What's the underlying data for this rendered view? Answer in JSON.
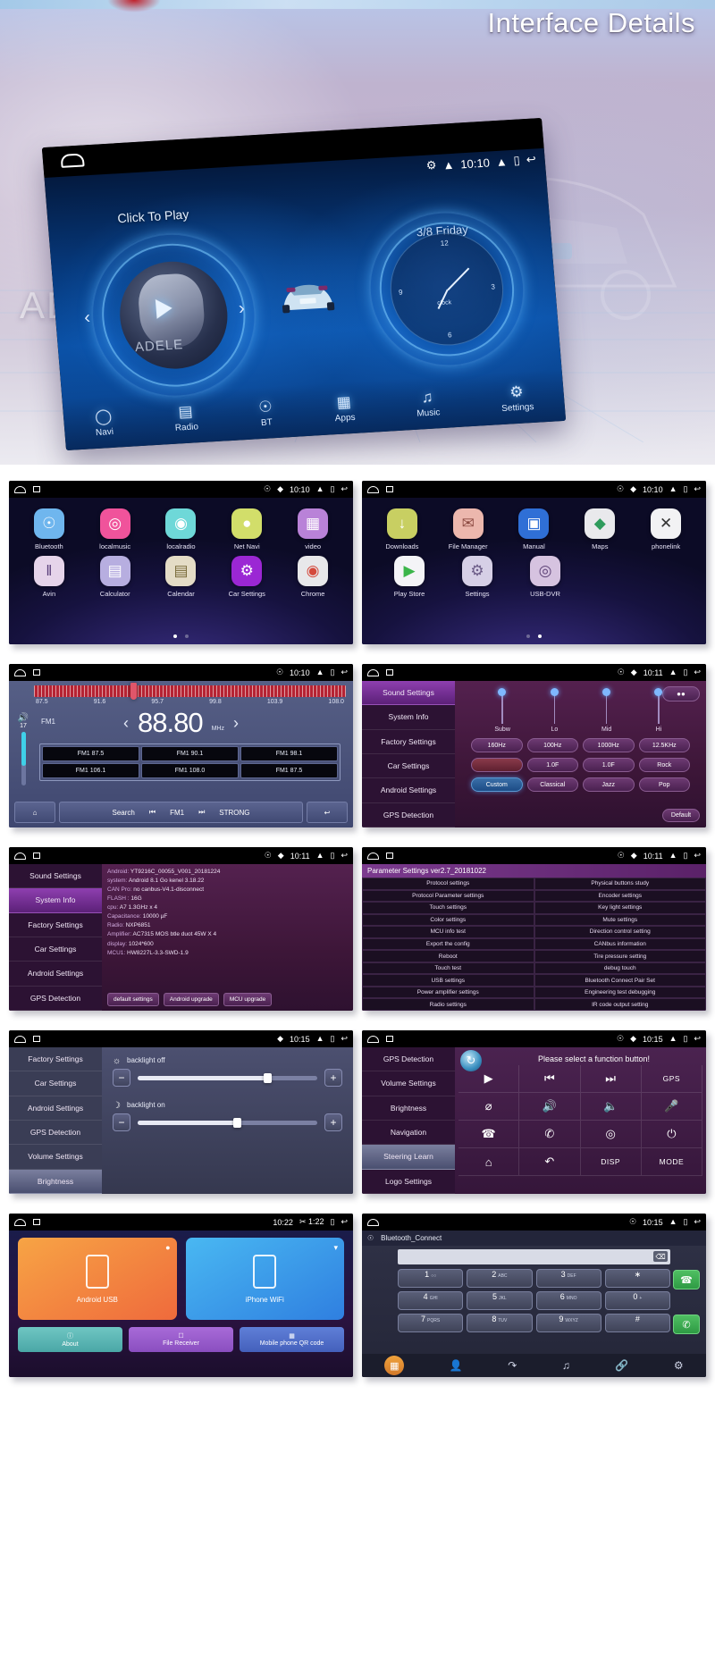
{
  "hero": {
    "title": "Interface Details",
    "watermark": "AD",
    "device": {
      "status": {
        "bt_icon": "bluetooth-icon",
        "wifi_icon": "wifi-icon",
        "time": "10:10",
        "up_icon": "chevron-up-icon",
        "recent_icon": "recents-icon",
        "back_icon": "back-icon"
      },
      "click_to_play": "Click To Play",
      "date": "3/8 Friday",
      "album_artist": "ADELE",
      "clock_label": "clock",
      "clock_numbers": [
        "12",
        "3",
        "6",
        "9"
      ],
      "nav": [
        {
          "label": "Navi",
          "icon": "location-pin-icon"
        },
        {
          "label": "Radio",
          "icon": "radio-icon"
        },
        {
          "label": "BT",
          "icon": "bluetooth-icon"
        },
        {
          "label": "Apps",
          "icon": "apps-grid-icon"
        },
        {
          "label": "Music",
          "icon": "music-note-icon"
        },
        {
          "label": "Settings",
          "icon": "gear-icon"
        }
      ]
    }
  },
  "panels": {
    "apps_page1": {
      "status_time": "10:10",
      "row1": [
        {
          "label": "Bluetooth",
          "icon": "bluetooth-icon",
          "glyph": "ᛗ",
          "bg": "#6fb6ee"
        },
        {
          "label": "localmusic",
          "icon": "music-play-icon",
          "glyph": "▶",
          "bg": "#f0539b"
        },
        {
          "label": "localradio",
          "icon": "radio-icon",
          "glyph": "◉",
          "bg": "#6ed8d8"
        },
        {
          "label": "Net Navi",
          "icon": "location-pin-icon",
          "glyph": "●",
          "bg": "#d2de6a"
        },
        {
          "label": "video",
          "icon": "film-clap-icon",
          "glyph": "⌸",
          "bg": "#b982d8"
        }
      ],
      "row2": [
        {
          "label": "Avin",
          "icon": "avin-icon",
          "glyph": "‖",
          "bg": "#e6d4ea"
        },
        {
          "label": "Calculator",
          "icon": "calculator-icon",
          "glyph": "➕",
          "bg": "#b7aee0"
        },
        {
          "label": "Calendar",
          "icon": "calendar-icon",
          "glyph": "▤",
          "bg": "#e4dcc6"
        },
        {
          "label": "Car Settings",
          "icon": "gear-icon",
          "glyph": "⚙",
          "bg": "#9b27d4"
        },
        {
          "label": "Chrome",
          "icon": "chrome-icon",
          "glyph": "●",
          "bg": "#e8e8ea"
        }
      ],
      "page_dots": 2,
      "active_dot": 0
    },
    "apps_page2": {
      "status_time": "10:10",
      "row1": [
        {
          "label": "Downloads",
          "icon": "download-icon",
          "glyph": "⬇",
          "bg": "#c8cf62"
        },
        {
          "label": "File Manager",
          "icon": "file-manager-icon",
          "glyph": "✉",
          "bg": "#ecb7ad"
        },
        {
          "label": "Manual",
          "icon": "book-icon",
          "glyph": "▧",
          "bg": "#2f6fd6"
        },
        {
          "label": "Maps",
          "icon": "maps-icon",
          "glyph": "◢",
          "bg": "#e9e9ec"
        },
        {
          "label": "phonelink",
          "icon": "phonelink-icon",
          "glyph": "✕",
          "bg": "#f2f2f4"
        }
      ],
      "row2": [
        {
          "label": "Play Store",
          "icon": "play-store-icon",
          "glyph": "▶",
          "bg": "#f4f4f7"
        },
        {
          "label": "Settings",
          "icon": "gear-icon",
          "glyph": "⚙",
          "bg": "#d6cfe6"
        },
        {
          "label": "USB-DVR",
          "icon": "camera-icon",
          "glyph": "◎",
          "bg": "#d6c3e0"
        }
      ],
      "page_dots": 2,
      "active_dot": 1
    },
    "radio": {
      "status_time": "10:10",
      "scale": [
        "87.5",
        "91.6",
        "95.7",
        "99.8",
        "103.9",
        "108.0"
      ],
      "band": "FM1",
      "frequency": "88.80",
      "unit": "MHz",
      "volume_icon": "speaker-icon",
      "volume_value": "17",
      "presets": [
        "FM1 87.5",
        "FM1 90.1",
        "FM1 98.1",
        "FM1 106.1",
        "FM1 108.0",
        "FM1 87.5"
      ],
      "buttons": {
        "home": "home-icon",
        "search": "Search",
        "prev": "prev-icon",
        "band": "FM1",
        "next": "next-icon",
        "strong": "STRONG",
        "back": "back-icon"
      }
    },
    "sound_settings": {
      "status_time": "10:11",
      "menu": [
        "Sound Settings",
        "System Info",
        "Factory Settings",
        "Car Settings",
        "Android Settings",
        "GPS Detection"
      ],
      "active_menu": 0,
      "sliders": [
        "Subw",
        "Lo",
        "Mid",
        "Hi"
      ],
      "freq_row": [
        "160Hz",
        "100Hz",
        "1000Hz",
        "12.5KHz"
      ],
      "gain_row": [
        "",
        "1.0F",
        "1.0F",
        "Rock"
      ],
      "preset_row": [
        "Custom",
        "Classical",
        "Jazz",
        "Pop"
      ],
      "selected_preset": "Custom",
      "fader_button": "fader-icon",
      "default_button": "Default"
    },
    "system_info": {
      "status_time": "10:11",
      "menu": [
        "Sound Settings",
        "System Info",
        "Factory Settings",
        "Car Settings",
        "Android Settings",
        "GPS Detection"
      ],
      "active_menu": 1,
      "rows": [
        {
          "k": "Android:",
          "v": "YT9216C_00055_V001_20181224"
        },
        {
          "k": "system:",
          "v": "Android 8.1 Go    kenel  3.18.22"
        },
        {
          "k": "CAN Pro:",
          "v": "no canbus-V4.1-disconnect"
        },
        {
          "k": "FLASH :",
          "v": "16G"
        },
        {
          "k": "cpu:",
          "v": "A7 1.3GHz x 4"
        },
        {
          "k": "Capacitance:",
          "v": "10000 µF"
        },
        {
          "k": "Radio:",
          "v": "NXP6851"
        },
        {
          "k": "Amplifier:",
          "v": "AC7315 MOS btle duot 45W X 4"
        },
        {
          "k": "display:",
          "v": "1024*600"
        },
        {
          "k": "MCU1:",
          "v": "HW8227L-3.3-SWD-1.9"
        }
      ],
      "buttons": [
        "default settings",
        "Android upgrade",
        "MCU upgrade"
      ]
    },
    "parameter_settings": {
      "status_time": "10:11",
      "title": "Parameter Settings ver2.7_20181022",
      "rows": [
        [
          "Protocol settings",
          "Physical buttons study"
        ],
        [
          "Protocol Parameter settings",
          "Encoder settings"
        ],
        [
          "Touch settings",
          "Key light settings"
        ],
        [
          "Color settings",
          "Mute settings"
        ],
        [
          "MCU info test",
          "Direction control setting"
        ],
        [
          "Export the config",
          "CANbus information"
        ],
        [
          "Reboot",
          "Tire pressure setting"
        ],
        [
          "Touch test",
          "debug touch"
        ],
        [
          "USB settings",
          "Bluetooth Connect Pair Set"
        ],
        [
          "Power amplifier settings",
          "Engineering test debugging"
        ],
        [
          "Radio settings",
          "IR code output setting"
        ]
      ]
    },
    "brightness": {
      "status_time": "10:15",
      "menu": [
        "Factory Settings",
        "Car Settings",
        "Android Settings",
        "GPS Detection",
        "Volume Settings",
        "Brightness"
      ],
      "active_menu": 5,
      "controls": [
        {
          "icon": "sun-icon",
          "label": "backlight off",
          "value": 72
        },
        {
          "icon": "moon-icon",
          "label": "backlight on",
          "value": 55
        }
      ],
      "minus": "−",
      "plus": "+"
    },
    "steering_learn": {
      "status_time": "10:15",
      "menu": [
        "GPS Detection",
        "Volume Settings",
        "Brightness",
        "Navigation",
        "Steering Learn",
        "Logo Settings"
      ],
      "active_menu": 4,
      "prompt": "Please select a function button!",
      "logo_icon": "steering-sync-icon",
      "buttons": [
        {
          "icon": "play-icon",
          "glyph": "▶"
        },
        {
          "icon": "prev-track-icon",
          "glyph": "⏮"
        },
        {
          "icon": "next-track-icon",
          "glyph": "⏭"
        },
        {
          "icon": "gps-label",
          "glyph": "GPS",
          "text": true
        },
        {
          "icon": "mute-icon",
          "glyph": "⌀"
        },
        {
          "icon": "volume-up-icon",
          "glyph": "ὐA"
        },
        {
          "icon": "volume-down-icon",
          "glyph": "ὐ9"
        },
        {
          "icon": "mic-icon",
          "glyph": "Ἲ4"
        },
        {
          "icon": "call-icon",
          "glyph": "☎"
        },
        {
          "icon": "hangup-icon",
          "glyph": "✆"
        },
        {
          "icon": "camera-icon",
          "glyph": "὏7"
        },
        {
          "icon": "power-icon",
          "glyph": "⏻"
        },
        {
          "icon": "home-icon",
          "glyph": "⌂"
        },
        {
          "icon": "back-icon",
          "glyph": "↶"
        },
        {
          "icon": "disp-label",
          "glyph": "DISP",
          "text": true
        },
        {
          "icon": "mode-label",
          "glyph": "MODE",
          "text": true
        }
      ]
    },
    "phonelink": {
      "status_time": "10:22",
      "status_extra": "✂ 1:22",
      "cards": [
        {
          "label": "Android USB",
          "sub": "Android",
          "badge": "dot-badge",
          "style": "orange"
        },
        {
          "label": "iPhone WiFi",
          "sub": "iPhone",
          "badge": "wifi-icon",
          "style": "blue"
        }
      ],
      "buttons": [
        {
          "label": "About",
          "icon": "info-icon",
          "style": "t"
        },
        {
          "label": "File Receiver",
          "icon": "file-icon",
          "style": "p"
        },
        {
          "label": "Mobile phone QR code",
          "icon": "qr-icon",
          "style": "b"
        }
      ]
    },
    "bluetooth_dialer": {
      "status_time": "10:15",
      "title": "Bluetooth_Connect",
      "back_icon": "bt-back-icon",
      "input_value": "",
      "delete_icon": "backspace-icon",
      "keys": [
        {
          "main": "1",
          "sub": "○○"
        },
        {
          "main": "2",
          "sub": "ABC"
        },
        {
          "main": "3",
          "sub": "DEF"
        },
        {
          "main": "∗",
          "sub": ""
        },
        {
          "main": "4",
          "sub": "GHI"
        },
        {
          "main": "5",
          "sub": "JKL"
        },
        {
          "main": "6",
          "sub": "MNO"
        },
        {
          "main": "0",
          "sub": "+"
        },
        {
          "main": "7",
          "sub": "PQRS"
        },
        {
          "main": "8",
          "sub": "TUV"
        },
        {
          "main": "9",
          "sub": "WXYZ"
        },
        {
          "main": "#",
          "sub": ""
        }
      ],
      "call_icon": "call-icon",
      "hangup_icon": "hangup-icon",
      "tabs": [
        {
          "icon": "dialpad-icon",
          "glyph": "∷"
        },
        {
          "icon": "contacts-icon",
          "glyph": "὆4"
        },
        {
          "icon": "call-history-icon",
          "glyph": "⤴"
        },
        {
          "icon": "bt-music-icon",
          "glyph": "♫"
        },
        {
          "icon": "link-icon",
          "glyph": "⚭"
        },
        {
          "icon": "gear-icon",
          "glyph": "⚙"
        }
      ]
    }
  }
}
